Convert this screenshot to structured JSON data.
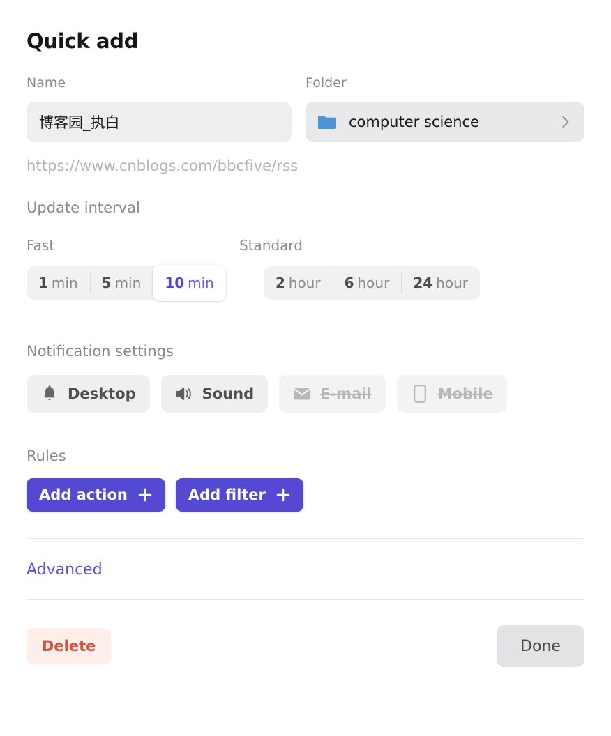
{
  "dialog": {
    "title": "Quick add"
  },
  "name_field": {
    "label": "Name",
    "value": "博客园_执白",
    "placeholder": "Name"
  },
  "folder_field": {
    "label": "Folder",
    "value": "computer science",
    "icon": "folder-icon",
    "chevron": "chevron-right-icon",
    "folder_color": "#4f94d4"
  },
  "url": "https://www.cnblogs.com/bbcfive/rss",
  "update_interval": {
    "heading": "Update interval",
    "groups": [
      {
        "name": "fast",
        "label": "Fast",
        "options": [
          {
            "num": "1",
            "unit": "min",
            "selected": false
          },
          {
            "num": "5",
            "unit": "min",
            "selected": false
          },
          {
            "num": "10",
            "unit": "min",
            "selected": true
          }
        ]
      },
      {
        "name": "standard",
        "label": "Standard",
        "options": [
          {
            "num": "2",
            "unit": "hour",
            "selected": false
          },
          {
            "num": "6",
            "unit": "hour",
            "selected": false
          },
          {
            "num": "24",
            "unit": "hour",
            "selected": false
          }
        ]
      }
    ],
    "selected_value": "10 min"
  },
  "notifications": {
    "heading": "Notification settings",
    "options": [
      {
        "label": "Desktop",
        "icon": "bell-icon",
        "enabled": true
      },
      {
        "label": "Sound",
        "icon": "speaker-icon",
        "enabled": true
      },
      {
        "label": "E-mail",
        "icon": "envelope-icon",
        "enabled": false
      },
      {
        "label": "Mobile",
        "icon": "phone-icon",
        "enabled": false
      }
    ]
  },
  "rules": {
    "heading": "Rules",
    "buttons": [
      {
        "label": "Add action",
        "icon": "plus-icon"
      },
      {
        "label": "Add filter",
        "icon": "plus-icon"
      }
    ],
    "accent_color": "#5449d2"
  },
  "advanced_link": "Advanced",
  "footer": {
    "delete_label": "Delete",
    "delete_color": "#d4553f",
    "done_label": "Done"
  }
}
